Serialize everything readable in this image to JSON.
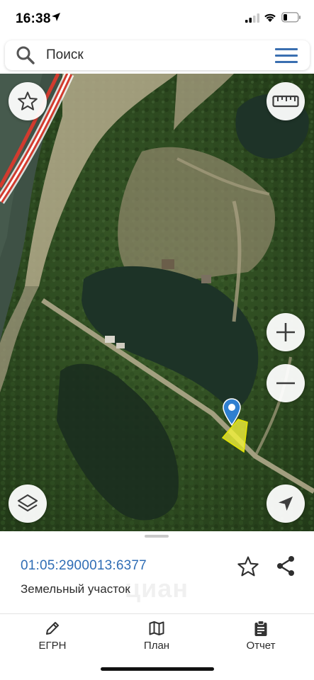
{
  "status_bar": {
    "time": "16:38",
    "location_icon": "location-arrow-icon",
    "signal_icon": "cellular-signal-icon",
    "wifi_icon": "wifi-icon",
    "battery_icon": "battery-low-icon"
  },
  "search": {
    "placeholder": "Поиск",
    "icon": "search-icon",
    "menu_icon": "hamburger-menu-icon"
  },
  "map": {
    "controls": {
      "favorite": "star-outline-icon",
      "ruler": "ruler-icon",
      "zoom_in": "plus-icon",
      "zoom_out": "minus-icon",
      "layers": "layers-icon",
      "locate": "navigation-arrow-icon"
    },
    "marker_icon": "map-pin-icon",
    "parcel_color": "#f2f23a",
    "marker_color": "#2f7fd0"
  },
  "parcel": {
    "cadastral_number": "01:05:2900013:6377",
    "type": "Земельный участок",
    "watermark": "циан",
    "favorite_icon": "star-outline-icon",
    "share_icon": "share-icon"
  },
  "tabs": [
    {
      "label": "ЕГРН",
      "icon": "pencil-icon"
    },
    {
      "label": "План",
      "icon": "map-icon"
    },
    {
      "label": "Отчет",
      "icon": "clipboard-icon"
    }
  ],
  "colors": {
    "accent": "#2f6db5",
    "menu": "#3a6fb0"
  }
}
